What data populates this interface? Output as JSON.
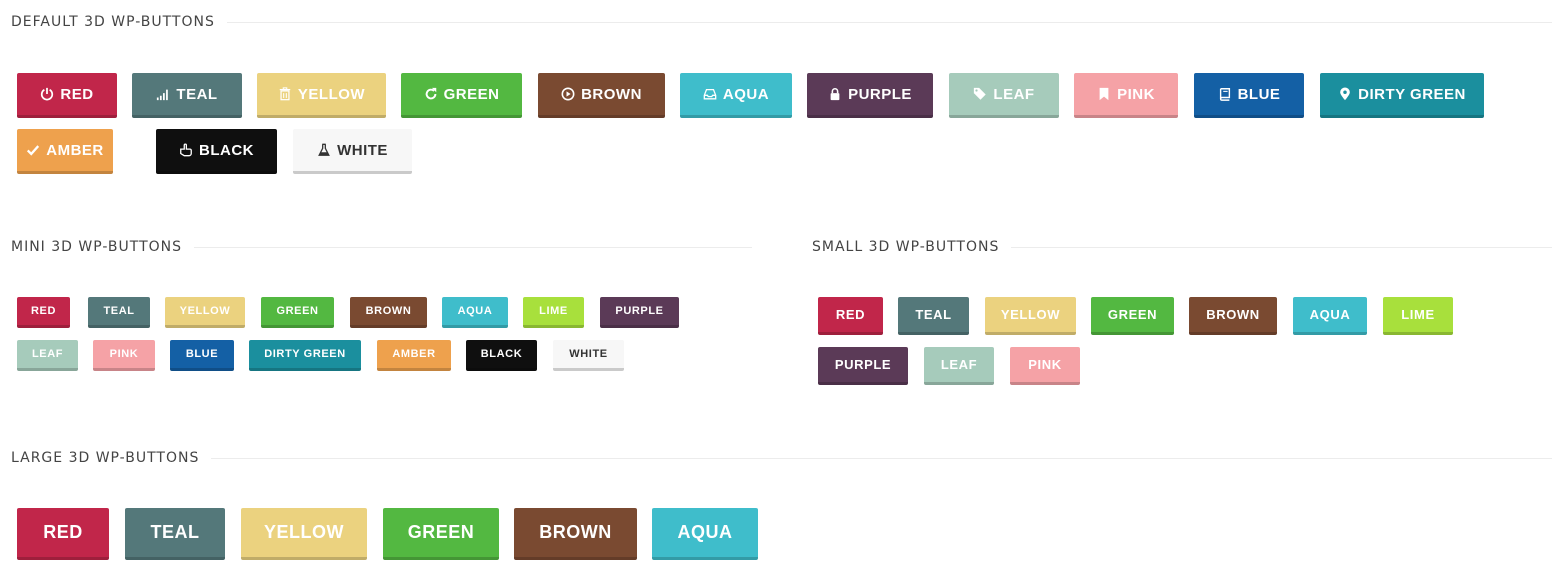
{
  "sections": {
    "default": {
      "title": "DEFAULT 3D WP-BUTTONS"
    },
    "mini": {
      "title": "MINI 3D WP-BUTTONS"
    },
    "small": {
      "title": "SMALL 3D WP-BUTTONS"
    },
    "large": {
      "title": "LARGE 3D WP-BUTTONS"
    }
  },
  "default_buttons": [
    {
      "label": "RED",
      "icon": "power-icon",
      "color": "#C1264A"
    },
    {
      "label": "TEAL",
      "icon": "signal-icon",
      "color": "#54787A"
    },
    {
      "label": "YELLOW",
      "icon": "trash-icon",
      "color": "#EBD27F"
    },
    {
      "label": "GREEN",
      "icon": "refresh-icon",
      "color": "#53B841"
    },
    {
      "label": "BROWN",
      "icon": "play-circle-icon",
      "color": "#7A4A31"
    },
    {
      "label": "AQUA",
      "icon": "inbox-icon",
      "color": "#3FBDCB"
    },
    {
      "label": "PURPLE",
      "icon": "lock-icon",
      "color": "#5B3A57"
    },
    {
      "label": "LEAF",
      "icon": "tags-icon",
      "color": "#A6CBBB"
    },
    {
      "label": "PINK",
      "icon": "bookmark-icon",
      "color": "#F5A2A6"
    },
    {
      "label": "BLUE",
      "icon": "book-icon",
      "color": "#1460A5"
    },
    {
      "label": "DIRTY GREEN",
      "icon": "map-marker-icon",
      "color": "#1B8F9E"
    },
    {
      "label": "AMBER",
      "icon": "check-icon",
      "color": "#EEA14D"
    },
    {
      "label": "BLACK",
      "icon": "hand-pointer-icon",
      "color": "#0F0F0F"
    },
    {
      "label": "WHITE",
      "icon": "flask-icon",
      "color": "#F7F7F7"
    }
  ],
  "mini_buttons": [
    {
      "label": "RED",
      "color": "#C1264A"
    },
    {
      "label": "TEAL",
      "color": "#54787A"
    },
    {
      "label": "YELLOW",
      "color": "#EBD27F"
    },
    {
      "label": "GREEN",
      "color": "#53B841"
    },
    {
      "label": "BROWN",
      "color": "#7A4A31"
    },
    {
      "label": "AQUA",
      "color": "#3FBDCB"
    },
    {
      "label": "LIME",
      "color": "#A8E03C"
    },
    {
      "label": "PURPLE",
      "color": "#5B3A57"
    },
    {
      "label": "LEAF",
      "color": "#A6CBBB"
    },
    {
      "label": "PINK",
      "color": "#F5A2A6"
    },
    {
      "label": "BLUE",
      "color": "#1460A5"
    },
    {
      "label": "DIRTY GREEN",
      "color": "#1B8F9E"
    },
    {
      "label": "AMBER",
      "color": "#EEA14D"
    },
    {
      "label": "BLACK",
      "color": "#0F0F0F"
    },
    {
      "label": "WHITE",
      "color": "#F7F7F7"
    }
  ],
  "small_buttons": [
    {
      "label": "RED",
      "color": "#C1264A"
    },
    {
      "label": "TEAL",
      "color": "#54787A"
    },
    {
      "label": "YELLOW",
      "color": "#EBD27F"
    },
    {
      "label": "GREEN",
      "color": "#53B841"
    },
    {
      "label": "BROWN",
      "color": "#7A4A31"
    },
    {
      "label": "AQUA",
      "color": "#3FBDCB"
    },
    {
      "label": "LIME",
      "color": "#A8E03C"
    },
    {
      "label": "PURPLE",
      "color": "#5B3A57"
    },
    {
      "label": "LEAF",
      "color": "#A6CBBB"
    },
    {
      "label": "PINK",
      "color": "#F5A2A6"
    }
  ],
  "large_buttons": [
    {
      "label": "RED",
      "color": "#C1264A"
    },
    {
      "label": "TEAL",
      "color": "#54787A"
    },
    {
      "label": "YELLOW",
      "color": "#EBD27F"
    },
    {
      "label": "GREEN",
      "color": "#53B841"
    },
    {
      "label": "BROWN",
      "color": "#7A4A31"
    },
    {
      "label": "AQUA",
      "color": "#3FBDCB"
    }
  ]
}
